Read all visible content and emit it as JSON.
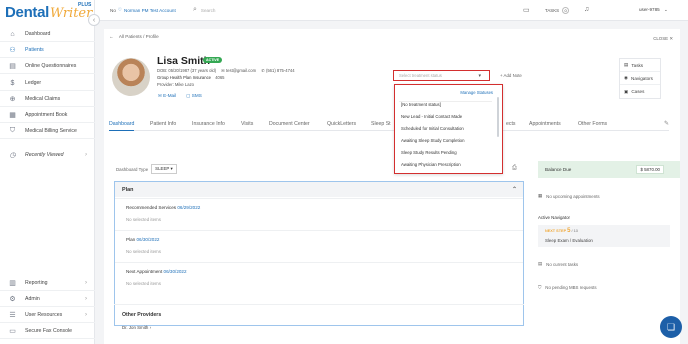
{
  "brand": {
    "dental": "Dental",
    "writer": "Writer",
    "plus": "PLUS"
  },
  "sidebar": {
    "items": [
      {
        "label": "Dashboard",
        "icon": "home-icon"
      },
      {
        "label": "Patients",
        "icon": "patients-icon"
      },
      {
        "label": "Online Questionnaires",
        "icon": "questionnaire-icon"
      },
      {
        "label": "Ledger",
        "icon": "dollar-icon"
      },
      {
        "label": "Medical Claims",
        "icon": "claims-icon"
      },
      {
        "label": "Appointment Book",
        "icon": "calendar-icon"
      },
      {
        "label": "Medical Billing Service",
        "icon": "shield-icon"
      }
    ],
    "recent": "Recently Viewed",
    "bottom_items": [
      {
        "label": "Reporting",
        "icon": "reporting-icon"
      },
      {
        "label": "Admin",
        "icon": "admin-icon"
      },
      {
        "label": "User Resources",
        "icon": "resources-icon"
      },
      {
        "label": "Secure Fax Console",
        "icon": "fax-icon"
      }
    ]
  },
  "topbar": {
    "practice_prefix": "No",
    "practice_name": "Norman PM Test Account",
    "search_placeholder": "Search",
    "tasks_label": "TASKS",
    "tasks_count": "0",
    "user": "user-9785"
  },
  "breadcrumb": "All Patients / Profile",
  "close_label": "CLOSE",
  "patient": {
    "name": "Lisa Smith",
    "status": "ACTIVE",
    "dob": "DOB: 05/20/1987 (37 years old)",
    "email": "test@gmail.com",
    "phone": "(561) 875-4744",
    "insurance": "Group Health Plan Insurance",
    "insurance_id": "4065",
    "provider": "Provider: Mike Lazo",
    "email_link": "E-Mail",
    "sms_link": "SMS"
  },
  "status_select": {
    "placeholder": "Select treatment status"
  },
  "add_note": "Add Note",
  "side_actions": [
    "Tasks",
    "Navigators",
    "Cases"
  ],
  "tabs": [
    "Dashboard",
    "Patient Info",
    "Insurance Info",
    "Visits",
    "Document Center",
    "QuickLetters",
    "Sleep St",
    "ects",
    "Appointments",
    "Other Forms"
  ],
  "dashboard_type": {
    "label": "Dashboard Type",
    "value": "SLEEP"
  },
  "plan": {
    "title": "Plan",
    "sections": [
      {
        "label": "Recommended Services",
        "date": "06/29/2022",
        "empty": "No selected items"
      },
      {
        "label": "Plan",
        "date": "06/30/2022",
        "empty": "No selected items"
      },
      {
        "label": "Next Appointment",
        "date": "06/30/2022",
        "empty": "No selected items"
      }
    ]
  },
  "other_providers": {
    "title": "Other Providers",
    "name": "Dr. Jon Smith"
  },
  "right_panel": {
    "balance_label": "Balance Due",
    "balance_amount": "$ 5870.00",
    "no_appointments": "No upcoming appointments",
    "active_navigator": "Active Navigator",
    "next_step": "NEXT STEP",
    "step_number": "5",
    "step_total": "/ 13",
    "step_label": "Sleep Exam / Evaluation",
    "no_tasks": "No current tasks",
    "no_mbs": "No pending MBS requests"
  },
  "dropdown": {
    "manage": "Manage Statuses",
    "options": [
      "[No treatment status]",
      "New Lead - Initial Contact Made",
      "Scheduled for Initial Consultation",
      "Awaiting Sleep Study Completion",
      "Sleep Study Results Pending",
      "Awaiting Physician Prescription"
    ]
  },
  "colors": {
    "brand_blue": "#1d6fb8",
    "accent_orange": "#f0a93a",
    "active_green": "#34a853",
    "highlight_red": "#d32f2f"
  }
}
